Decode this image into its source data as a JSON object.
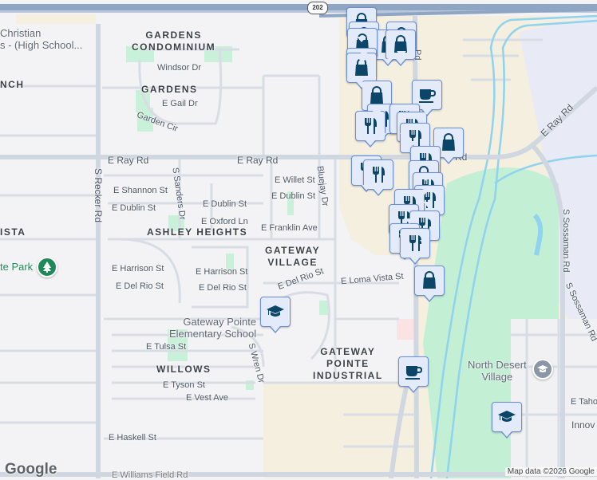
{
  "map": {
    "highway_shield": "202",
    "areas": {
      "gardens_condo": "GARDENS\nCONDOMINIUM",
      "gardens": "GARDENS",
      "ranch": "NCH",
      "vista": "ISTA",
      "ashley_heights": "ASHLEY HEIGHTS",
      "gateway_village": "GATEWAY\nVILLAGE",
      "willows": "WILLOWS",
      "gateway_industrial": "GATEWAY\nPOINTE\nINDUSTRIAL"
    },
    "streets": {
      "windsor": "Windsor Dr",
      "gail": "E Gail Dr",
      "garden_cir": "Garden Cir",
      "ray_w": "E Ray Rd",
      "ray_c": "E Ray Rd",
      "ray_e": "Rd",
      "ray_ne": "E Ray Rd",
      "recker": "S Recker Rd",
      "sanders": "S Sanders Dr",
      "shannon": "E Shannon St",
      "dublin_w": "E Dublin St",
      "dublin_c": "E Dublin St",
      "dublin_e": "E Dublin St",
      "willet": "E Willet St",
      "oxford": "E Oxford Ln",
      "franklin": "E Franklin Ave",
      "bluejay": "Bluejay Dr",
      "harrison_w": "E Harrison St",
      "harrison_e": "E Harrison St",
      "delrio_w": "E Del Rio St",
      "delrio_c": "E Del Rio St",
      "delrio_e": "E Del Rio St",
      "loma_vista": "E Loma Vista St",
      "tulsa": "E Tulsa St",
      "tyson": "E Tyson St",
      "vest": "E Vest Ave",
      "haskell": "E Haskell St",
      "wren": "S Wren Dr",
      "sossaman_1": "S Sossaman Rd",
      "sossaman_2": "S Sossaman Rd",
      "tahoe": "E Taho",
      "innov": "Innov",
      "pd": "Pd",
      "williams_field": "E Williams Field Rd",
      "shannon_w": "St"
    },
    "pois": {
      "christian_school": "Christian\ns - (High School...",
      "park": "te Park",
      "gateway_elem": "Gateway Pointe\nElementary School",
      "north_desert": "North Desert\nVillage"
    },
    "google_logo": "Google",
    "attribution": "Map data ©2026 Google",
    "colors": {
      "marker_bg": "#e3eaf9",
      "marker_border": "#6b8fd6",
      "icon": "#0b4669",
      "park_green": "#c3efd5",
      "commercial": "#f5efdf"
    }
  }
}
